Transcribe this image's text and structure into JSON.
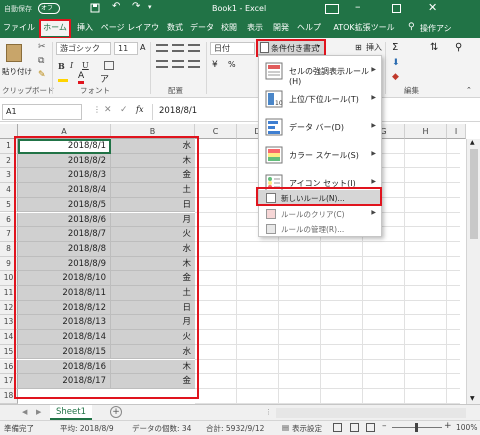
{
  "titlebar": {
    "autosave": "自動保存",
    "autosave_state": "オフ",
    "title": "Book1  -  Excel",
    "search": "操作アシ"
  },
  "tabs": [
    "ファイル",
    "ホーム",
    "挿入",
    "ページ レイアウト",
    "数式",
    "データ",
    "校閲",
    "表示",
    "開発",
    "ヘルプ",
    "ATOK拡張ツール"
  ],
  "ribbon": {
    "paste": "貼り付け",
    "font_name": "游ゴシック",
    "font_size": "11",
    "bold": "B",
    "italic": "I",
    "underline": "U",
    "number_format": "日付",
    "cond_format": "条件付き書式",
    "insert": "挿入",
    "groups": {
      "clipboard": "クリップボード",
      "font": "フォント",
      "alignment": "配置",
      "editing": "編集"
    }
  },
  "formulabar": {
    "namebox": "A1",
    "fx": "fx",
    "value": "2018/8/1"
  },
  "columns": [
    "A",
    "B",
    "C",
    "D",
    "E",
    "F",
    "G",
    "H",
    "I"
  ],
  "rows": [
    {
      "n": "1",
      "date": "2018/8/1",
      "day": "水"
    },
    {
      "n": "2",
      "date": "2018/8/2",
      "day": "木"
    },
    {
      "n": "3",
      "date": "2018/8/3",
      "day": "金"
    },
    {
      "n": "4",
      "date": "2018/8/4",
      "day": "土"
    },
    {
      "n": "5",
      "date": "2018/8/5",
      "day": "日"
    },
    {
      "n": "6",
      "date": "2018/8/6",
      "day": "月"
    },
    {
      "n": "7",
      "date": "2018/8/7",
      "day": "火"
    },
    {
      "n": "8",
      "date": "2018/8/8",
      "day": "水"
    },
    {
      "n": "9",
      "date": "2018/8/9",
      "day": "木"
    },
    {
      "n": "10",
      "date": "2018/8/10",
      "day": "金"
    },
    {
      "n": "11",
      "date": "2018/8/11",
      "day": "土"
    },
    {
      "n": "12",
      "date": "2018/8/12",
      "day": "日"
    },
    {
      "n": "13",
      "date": "2018/8/13",
      "day": "月"
    },
    {
      "n": "14",
      "date": "2018/8/14",
      "day": "火"
    },
    {
      "n": "15",
      "date": "2018/8/15",
      "day": "水"
    },
    {
      "n": "16",
      "date": "2018/8/16",
      "day": "木"
    },
    {
      "n": "17",
      "date": "2018/8/17",
      "day": "金"
    },
    {
      "n": "18",
      "date": "",
      "day": ""
    }
  ],
  "cf_menu": {
    "items": [
      "セルの強調表示ルール(H)",
      "上位/下位ルール(T)",
      "データ バー(D)",
      "カラー スケール(S)",
      "アイコン セット(I)"
    ],
    "new_rule": "新しいルール(N)...",
    "clear_rules": "ルールのクリア(C)",
    "manage_rules": "ルールの管理(R)..."
  },
  "sheet": {
    "name": "Sheet1",
    "add": "+"
  },
  "status": {
    "ready": "準備完了",
    "average": "平均: 2018/8/9",
    "count": "データの個数: 34",
    "sum": "合計: 5932/9/12",
    "display_settings": "表示設定",
    "zoom": "100%"
  },
  "colors": {
    "excel_green": "#217346",
    "highlight_red": "#e0141e",
    "selection_gray": "#d0d0d0"
  }
}
